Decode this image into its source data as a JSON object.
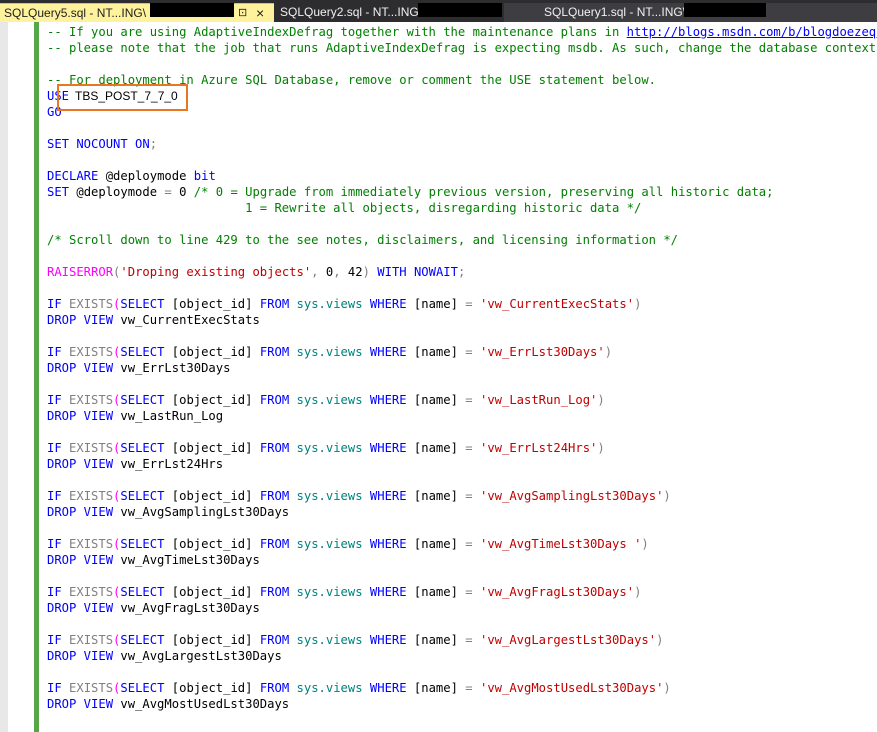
{
  "tabs": [
    {
      "title": "SQLQuery5.sql - NT...ING\\",
      "pin": "⊡",
      "close": "×"
    },
    {
      "title": "SQLQuery2.sql - NT...ING\\"
    },
    {
      "title": "SQLQuery1.sql - NT...ING\\"
    }
  ],
  "editor": {
    "use_database": "TBS_POST_7_7_0",
    "lines": [
      [
        [
          "c",
          "-- If you are using AdaptiveIndexDefrag together with the maintenance plans in "
        ],
        [
          "lnk",
          "http://blogs.msdn.com/b/blogdoezequiel/a"
        ]
      ],
      [
        [
          "c",
          "-- please note that the job that runs AdaptiveIndexDefrag is expecting msdb. As such, change the database context accor"
        ]
      ],
      [],
      [
        [
          "c",
          "-- For deployment in Azure SQL Database, remove or comment the USE statement below."
        ]
      ],
      [
        [
          "k",
          "USE "
        ]
      ],
      [
        [
          "k",
          "GO"
        ]
      ],
      [],
      [
        [
          "k",
          "SET NOCOUNT ON"
        ],
        [
          "g",
          ";"
        ]
      ],
      [],
      [
        [
          "k",
          "DECLARE "
        ],
        [
          "",
          "@deploymode "
        ],
        [
          "k",
          "bit"
        ]
      ],
      [
        [
          "k",
          "SET "
        ],
        [
          "",
          "@deploymode "
        ],
        [
          "g",
          "= "
        ],
        [
          "",
          "0 "
        ],
        [
          "c",
          "/* 0 = Upgrade from immediately previous version, preserving all historic data;"
        ]
      ],
      [
        [
          "c",
          "                           1 = Rewrite all objects, disregarding historic data */"
        ]
      ],
      [],
      [
        [
          "c",
          "/* Scroll down to line 429 to the see notes, disclaimers, and licensing information */"
        ]
      ],
      [],
      [
        [
          "m",
          "RAISERROR"
        ],
        [
          "g",
          "("
        ],
        [
          "s",
          "'Droping existing objects'"
        ],
        [
          "g",
          ", "
        ],
        [
          "",
          "0"
        ],
        [
          "g",
          ", "
        ],
        [
          "",
          "42"
        ],
        [
          "g",
          ") "
        ],
        [
          "k",
          "WITH NOWAIT"
        ],
        [
          "g",
          ";"
        ]
      ],
      [],
      [
        [
          "k",
          "IF "
        ],
        [
          "g",
          "EXISTS"
        ],
        [
          "m",
          "("
        ],
        [
          "k",
          "SELECT "
        ],
        [
          "",
          "[object_id] "
        ],
        [
          "k",
          "FROM "
        ],
        [
          "t",
          "sys.views "
        ],
        [
          "k",
          "WHERE "
        ],
        [
          "",
          "[name] "
        ],
        [
          "g",
          "= "
        ],
        [
          "s",
          "'vw_CurrentExecStats'"
        ],
        [
          "g",
          ")"
        ]
      ],
      [
        [
          "k",
          "DROP VIEW "
        ],
        [
          "",
          "vw_CurrentExecStats"
        ]
      ],
      [],
      [
        [
          "k",
          "IF "
        ],
        [
          "g",
          "EXISTS"
        ],
        [
          "m",
          "("
        ],
        [
          "k",
          "SELECT "
        ],
        [
          "",
          "[object_id] "
        ],
        [
          "k",
          "FROM "
        ],
        [
          "t",
          "sys.views "
        ],
        [
          "k",
          "WHERE "
        ],
        [
          "",
          "[name] "
        ],
        [
          "g",
          "= "
        ],
        [
          "s",
          "'vw_ErrLst30Days'"
        ],
        [
          "g",
          ")"
        ]
      ],
      [
        [
          "k",
          "DROP VIEW "
        ],
        [
          "",
          "vw_ErrLst30Days"
        ]
      ],
      [],
      [
        [
          "k",
          "IF "
        ],
        [
          "g",
          "EXISTS"
        ],
        [
          "m",
          "("
        ],
        [
          "k",
          "SELECT "
        ],
        [
          "",
          "[object_id] "
        ],
        [
          "k",
          "FROM "
        ],
        [
          "t",
          "sys.views "
        ],
        [
          "k",
          "WHERE "
        ],
        [
          "",
          "[name] "
        ],
        [
          "g",
          "= "
        ],
        [
          "s",
          "'vw_LastRun_Log'"
        ],
        [
          "g",
          ")"
        ]
      ],
      [
        [
          "k",
          "DROP VIEW "
        ],
        [
          "",
          "vw_LastRun_Log"
        ]
      ],
      [],
      [
        [
          "k",
          "IF "
        ],
        [
          "g",
          "EXISTS"
        ],
        [
          "m",
          "("
        ],
        [
          "k",
          "SELECT "
        ],
        [
          "",
          "[object_id] "
        ],
        [
          "k",
          "FROM "
        ],
        [
          "t",
          "sys.views "
        ],
        [
          "k",
          "WHERE "
        ],
        [
          "",
          "[name] "
        ],
        [
          "g",
          "= "
        ],
        [
          "s",
          "'vw_ErrLst24Hrs'"
        ],
        [
          "g",
          ")"
        ]
      ],
      [
        [
          "k",
          "DROP VIEW "
        ],
        [
          "",
          "vw_ErrLst24Hrs"
        ]
      ],
      [],
      [
        [
          "k",
          "IF "
        ],
        [
          "g",
          "EXISTS"
        ],
        [
          "m",
          "("
        ],
        [
          "k",
          "SELECT "
        ],
        [
          "",
          "[object_id] "
        ],
        [
          "k",
          "FROM "
        ],
        [
          "t",
          "sys.views "
        ],
        [
          "k",
          "WHERE "
        ],
        [
          "",
          "[name] "
        ],
        [
          "g",
          "= "
        ],
        [
          "s",
          "'vw_AvgSamplingLst30Days'"
        ],
        [
          "g",
          ")"
        ]
      ],
      [
        [
          "k",
          "DROP VIEW "
        ],
        [
          "",
          "vw_AvgSamplingLst30Days"
        ]
      ],
      [],
      [
        [
          "k",
          "IF "
        ],
        [
          "g",
          "EXISTS"
        ],
        [
          "m",
          "("
        ],
        [
          "k",
          "SELECT "
        ],
        [
          "",
          "[object_id] "
        ],
        [
          "k",
          "FROM "
        ],
        [
          "t",
          "sys.views "
        ],
        [
          "k",
          "WHERE "
        ],
        [
          "",
          "[name] "
        ],
        [
          "g",
          "= "
        ],
        [
          "s",
          "'vw_AvgTimeLst30Days '"
        ],
        [
          "g",
          ")"
        ]
      ],
      [
        [
          "k",
          "DROP VIEW "
        ],
        [
          "",
          "vw_AvgTimeLst30Days"
        ]
      ],
      [],
      [
        [
          "k",
          "IF "
        ],
        [
          "g",
          "EXISTS"
        ],
        [
          "m",
          "("
        ],
        [
          "k",
          "SELECT "
        ],
        [
          "",
          "[object_id] "
        ],
        [
          "k",
          "FROM "
        ],
        [
          "t",
          "sys.views "
        ],
        [
          "k",
          "WHERE "
        ],
        [
          "",
          "[name] "
        ],
        [
          "g",
          "= "
        ],
        [
          "s",
          "'vw_AvgFragLst30Days'"
        ],
        [
          "g",
          ")"
        ]
      ],
      [
        [
          "k",
          "DROP VIEW "
        ],
        [
          "",
          "vw_AvgFragLst30Days"
        ]
      ],
      [],
      [
        [
          "k",
          "IF "
        ],
        [
          "g",
          "EXISTS"
        ],
        [
          "m",
          "("
        ],
        [
          "k",
          "SELECT "
        ],
        [
          "",
          "[object_id] "
        ],
        [
          "k",
          "FROM "
        ],
        [
          "t",
          "sys.views "
        ],
        [
          "k",
          "WHERE "
        ],
        [
          "",
          "[name] "
        ],
        [
          "g",
          "= "
        ],
        [
          "s",
          "'vw_AvgLargestLst30Days'"
        ],
        [
          "g",
          ")"
        ]
      ],
      [
        [
          "k",
          "DROP VIEW "
        ],
        [
          "",
          "vw_AvgLargestLst30Days"
        ]
      ],
      [],
      [
        [
          "k",
          "IF "
        ],
        [
          "g",
          "EXISTS"
        ],
        [
          "m",
          "("
        ],
        [
          "k",
          "SELECT "
        ],
        [
          "",
          "[object_id] "
        ],
        [
          "k",
          "FROM "
        ],
        [
          "t",
          "sys.views "
        ],
        [
          "k",
          "WHERE "
        ],
        [
          "",
          "[name] "
        ],
        [
          "g",
          "= "
        ],
        [
          "s",
          "'vw_AvgMostUsedLst30Days'"
        ],
        [
          "g",
          ")"
        ]
      ],
      [
        [
          "k",
          "DROP VIEW "
        ],
        [
          "",
          "vw_AvgMostUsedLst30Days"
        ]
      ]
    ]
  }
}
